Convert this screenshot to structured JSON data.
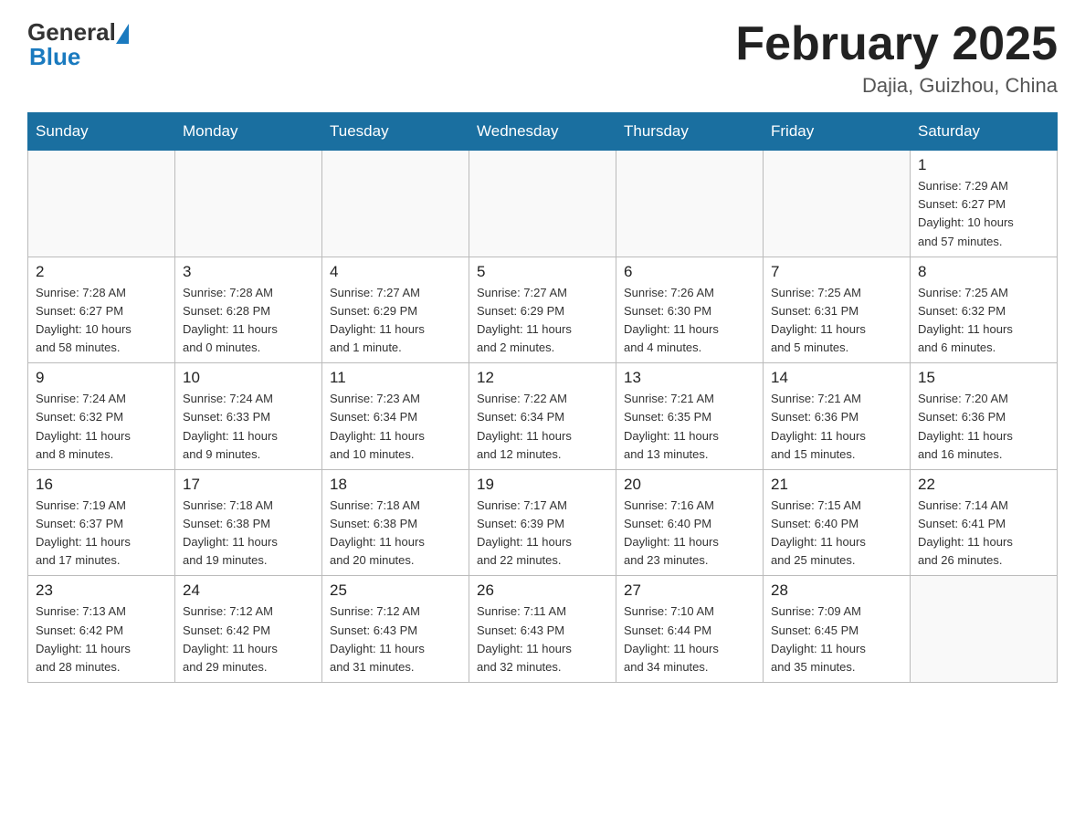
{
  "header": {
    "logo_general": "General",
    "logo_blue": "Blue",
    "month_title": "February 2025",
    "location": "Dajia, Guizhou, China"
  },
  "weekdays": [
    "Sunday",
    "Monday",
    "Tuesday",
    "Wednesday",
    "Thursday",
    "Friday",
    "Saturday"
  ],
  "weeks": [
    [
      {
        "day": "",
        "info": ""
      },
      {
        "day": "",
        "info": ""
      },
      {
        "day": "",
        "info": ""
      },
      {
        "day": "",
        "info": ""
      },
      {
        "day": "",
        "info": ""
      },
      {
        "day": "",
        "info": ""
      },
      {
        "day": "1",
        "info": "Sunrise: 7:29 AM\nSunset: 6:27 PM\nDaylight: 10 hours\nand 57 minutes."
      }
    ],
    [
      {
        "day": "2",
        "info": "Sunrise: 7:28 AM\nSunset: 6:27 PM\nDaylight: 10 hours\nand 58 minutes."
      },
      {
        "day": "3",
        "info": "Sunrise: 7:28 AM\nSunset: 6:28 PM\nDaylight: 11 hours\nand 0 minutes."
      },
      {
        "day": "4",
        "info": "Sunrise: 7:27 AM\nSunset: 6:29 PM\nDaylight: 11 hours\nand 1 minute."
      },
      {
        "day": "5",
        "info": "Sunrise: 7:27 AM\nSunset: 6:29 PM\nDaylight: 11 hours\nand 2 minutes."
      },
      {
        "day": "6",
        "info": "Sunrise: 7:26 AM\nSunset: 6:30 PM\nDaylight: 11 hours\nand 4 minutes."
      },
      {
        "day": "7",
        "info": "Sunrise: 7:25 AM\nSunset: 6:31 PM\nDaylight: 11 hours\nand 5 minutes."
      },
      {
        "day": "8",
        "info": "Sunrise: 7:25 AM\nSunset: 6:32 PM\nDaylight: 11 hours\nand 6 minutes."
      }
    ],
    [
      {
        "day": "9",
        "info": "Sunrise: 7:24 AM\nSunset: 6:32 PM\nDaylight: 11 hours\nand 8 minutes."
      },
      {
        "day": "10",
        "info": "Sunrise: 7:24 AM\nSunset: 6:33 PM\nDaylight: 11 hours\nand 9 minutes."
      },
      {
        "day": "11",
        "info": "Sunrise: 7:23 AM\nSunset: 6:34 PM\nDaylight: 11 hours\nand 10 minutes."
      },
      {
        "day": "12",
        "info": "Sunrise: 7:22 AM\nSunset: 6:34 PM\nDaylight: 11 hours\nand 12 minutes."
      },
      {
        "day": "13",
        "info": "Sunrise: 7:21 AM\nSunset: 6:35 PM\nDaylight: 11 hours\nand 13 minutes."
      },
      {
        "day": "14",
        "info": "Sunrise: 7:21 AM\nSunset: 6:36 PM\nDaylight: 11 hours\nand 15 minutes."
      },
      {
        "day": "15",
        "info": "Sunrise: 7:20 AM\nSunset: 6:36 PM\nDaylight: 11 hours\nand 16 minutes."
      }
    ],
    [
      {
        "day": "16",
        "info": "Sunrise: 7:19 AM\nSunset: 6:37 PM\nDaylight: 11 hours\nand 17 minutes."
      },
      {
        "day": "17",
        "info": "Sunrise: 7:18 AM\nSunset: 6:38 PM\nDaylight: 11 hours\nand 19 minutes."
      },
      {
        "day": "18",
        "info": "Sunrise: 7:18 AM\nSunset: 6:38 PM\nDaylight: 11 hours\nand 20 minutes."
      },
      {
        "day": "19",
        "info": "Sunrise: 7:17 AM\nSunset: 6:39 PM\nDaylight: 11 hours\nand 22 minutes."
      },
      {
        "day": "20",
        "info": "Sunrise: 7:16 AM\nSunset: 6:40 PM\nDaylight: 11 hours\nand 23 minutes."
      },
      {
        "day": "21",
        "info": "Sunrise: 7:15 AM\nSunset: 6:40 PM\nDaylight: 11 hours\nand 25 minutes."
      },
      {
        "day": "22",
        "info": "Sunrise: 7:14 AM\nSunset: 6:41 PM\nDaylight: 11 hours\nand 26 minutes."
      }
    ],
    [
      {
        "day": "23",
        "info": "Sunrise: 7:13 AM\nSunset: 6:42 PM\nDaylight: 11 hours\nand 28 minutes."
      },
      {
        "day": "24",
        "info": "Sunrise: 7:12 AM\nSunset: 6:42 PM\nDaylight: 11 hours\nand 29 minutes."
      },
      {
        "day": "25",
        "info": "Sunrise: 7:12 AM\nSunset: 6:43 PM\nDaylight: 11 hours\nand 31 minutes."
      },
      {
        "day": "26",
        "info": "Sunrise: 7:11 AM\nSunset: 6:43 PM\nDaylight: 11 hours\nand 32 minutes."
      },
      {
        "day": "27",
        "info": "Sunrise: 7:10 AM\nSunset: 6:44 PM\nDaylight: 11 hours\nand 34 minutes."
      },
      {
        "day": "28",
        "info": "Sunrise: 7:09 AM\nSunset: 6:45 PM\nDaylight: 11 hours\nand 35 minutes."
      },
      {
        "day": "",
        "info": ""
      }
    ]
  ]
}
